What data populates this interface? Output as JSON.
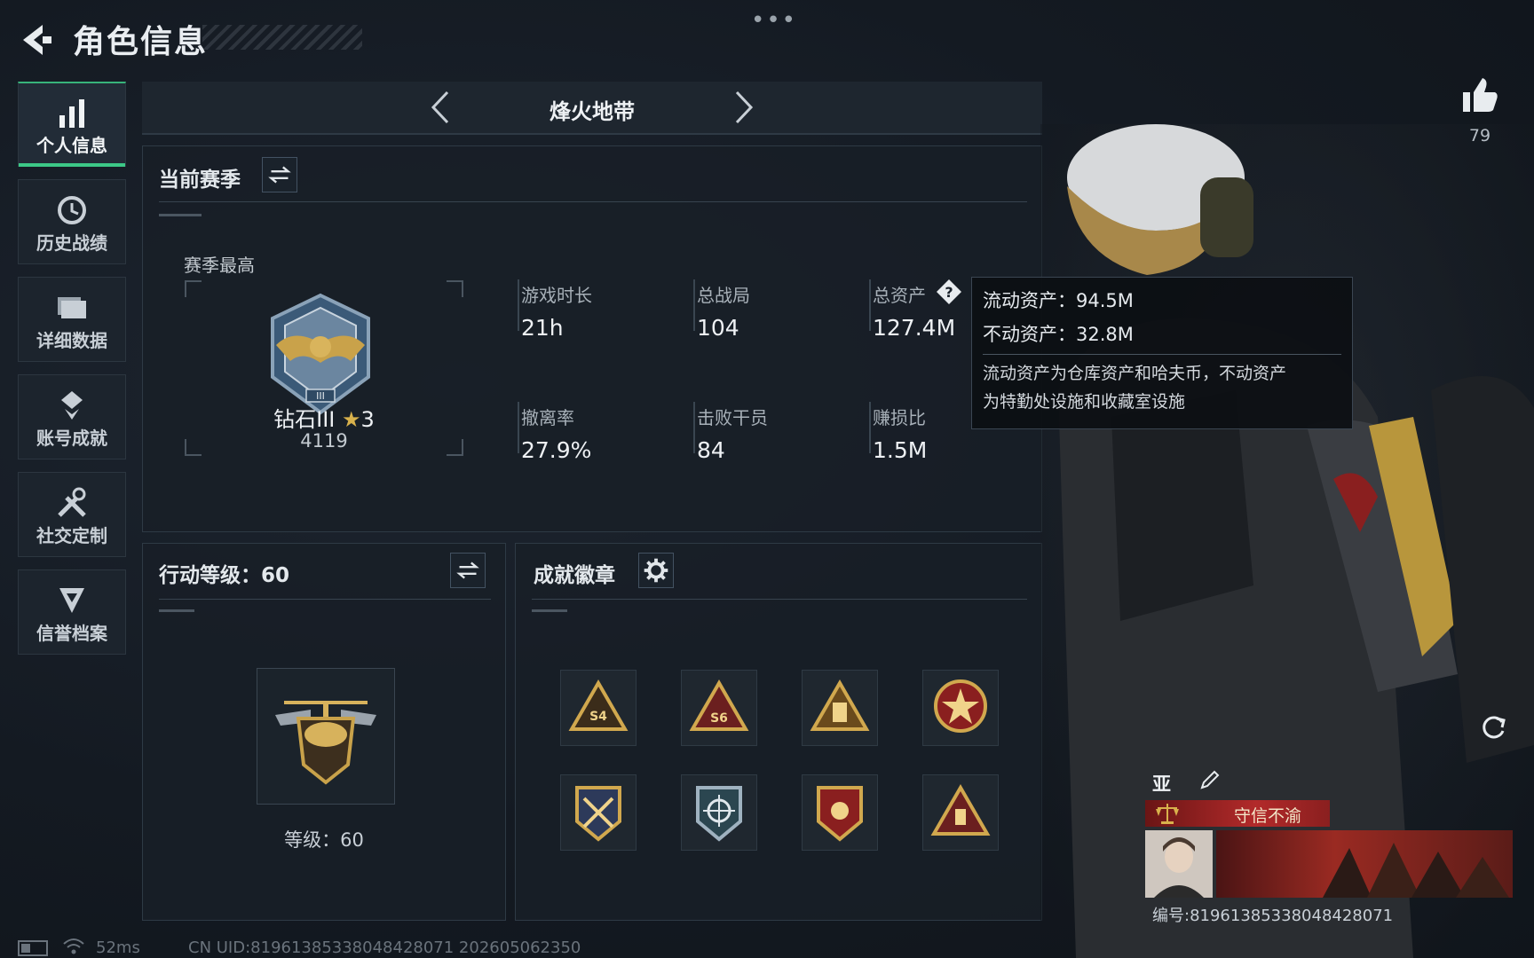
{
  "header": {
    "title": "角色信息",
    "more": "•••"
  },
  "sidebar": {
    "items": [
      {
        "label": "个人信息",
        "icon": "bar-chart-icon",
        "active": true
      },
      {
        "label": "历史战绩",
        "icon": "history-clock-icon"
      },
      {
        "label": "详细数据",
        "icon": "folder-icon"
      },
      {
        "label": "账号成就",
        "icon": "achievement-icon"
      },
      {
        "label": "社交定制",
        "icon": "tools-icon"
      },
      {
        "label": "信誉档案",
        "icon": "shield-crest-icon"
      }
    ]
  },
  "mode": {
    "title": "烽火地带"
  },
  "season": {
    "title": "当前赛季",
    "best_label": "赛季最高",
    "rank_name": "钻石III",
    "rank_stars": "3",
    "rank_score": "4119",
    "stats": [
      {
        "label": "游戏时长",
        "value": "21h"
      },
      {
        "label": "总战局",
        "value": "104"
      },
      {
        "label": "总资产",
        "value": "127.4M"
      },
      {
        "label": "撤离率",
        "value": "27.9%"
      },
      {
        "label": "击败干员",
        "value": "84"
      },
      {
        "label": "赚损比",
        "value": "1.5M"
      }
    ]
  },
  "tooltip": {
    "liquid": "流动资产：94.5M",
    "fixed": "不动资产：32.8M",
    "note_line1": "流动资产为仓库资产和哈夫币，不动资产",
    "note_line2": "为特勤处设施和收藏室设施"
  },
  "action_level": {
    "title": "行动等级：60",
    "level_text": "等级：60"
  },
  "badges": {
    "title": "成就徽章",
    "items": [
      "S4",
      "S6",
      "",
      "",
      "",
      "",
      "",
      ""
    ]
  },
  "character": {
    "likes": "79",
    "region": "亚",
    "credit_tag": "守信不渝",
    "id_text": "编号:8196138533804842807​1"
  },
  "status_bar": {
    "ping": "52ms",
    "uid_text": "CN UID:8196138533804842807​1 202605062350"
  },
  "colors": {
    "accent_green": "#3cc887",
    "gold": "#c9a24a",
    "credit_red": "#9e1f1f"
  }
}
